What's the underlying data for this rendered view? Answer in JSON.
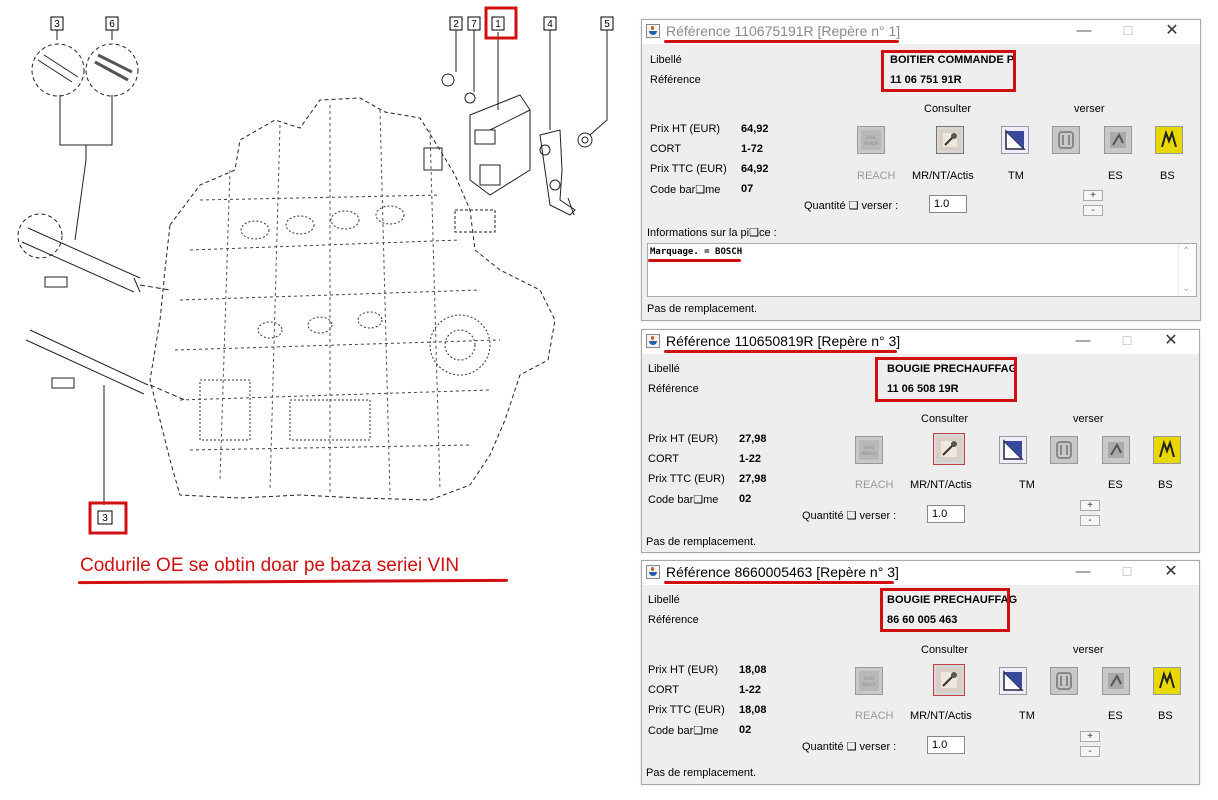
{
  "diagram": {
    "callouts": [
      {
        "id": "c3a",
        "label": "3"
      },
      {
        "id": "c6",
        "label": "6"
      },
      {
        "id": "c2",
        "label": "2"
      },
      {
        "id": "c7",
        "label": "7"
      },
      {
        "id": "c1",
        "label": "1"
      },
      {
        "id": "c4",
        "label": "4"
      },
      {
        "id": "c5",
        "label": "5"
      },
      {
        "id": "c3b",
        "label": "3"
      }
    ]
  },
  "caption": "Codurile OE se obtin doar pe baza seriei VIN",
  "common": {
    "libelle_label": "Libellé",
    "reference_label": "Référence",
    "consulter_label": "Consulter",
    "verser_label": "verser",
    "prix_ht_label": "Prix HT (EUR)",
    "cort_label": "CORT",
    "prix_ttc_label": "Prix TTC (EUR)",
    "code_barre_label": "Code bar❑me",
    "reach_label": "REACH",
    "mrnt_label": "MR/NT/Actis",
    "tm_label": "TM",
    "es_label": "ES",
    "bs_label": "BS",
    "quantite_label": "Quantité ❑ verser :",
    "plus": "+",
    "minus": "-",
    "remplacement": "Pas de remplacement.",
    "minimize": "—",
    "maximize": "☐",
    "close": "✕",
    "infos_label": "Informations sur la pi❑ce :"
  },
  "windows": [
    {
      "title": "Référence 110675191R [Repère n° 1]",
      "active": false,
      "libelle": "BOITIER COMMANDE P",
      "reference": "11 06 751 91R",
      "prix_ht": "64,92",
      "cort": "1-72",
      "prix_ttc": "64,92",
      "code_barre": "07",
      "quantite": "1.0",
      "infos_text": "Marquage. = BOSCH"
    },
    {
      "title": "Référence 110650819R [Repère n° 3]",
      "active": true,
      "libelle": "BOUGIE PRECHAUFFAG",
      "reference": "11 06 508 19R",
      "prix_ht": "27,98",
      "cort": "1-22",
      "prix_ttc": "27,98",
      "code_barre": "02",
      "quantite": "1.0"
    },
    {
      "title": "Référence 8660005463 [Repère n° 3]",
      "active": true,
      "libelle": "BOUGIE PRECHAUFFAG",
      "reference": "86 60 005 463",
      "prix_ht": "18,08",
      "cort": "1-22",
      "prix_ttc": "18,08",
      "code_barre": "02",
      "quantite": "1.0"
    }
  ],
  "colors": {
    "accent_red": "#d01010",
    "window_bg": "#eeeeee",
    "bs_yellow": "#e8d800"
  }
}
